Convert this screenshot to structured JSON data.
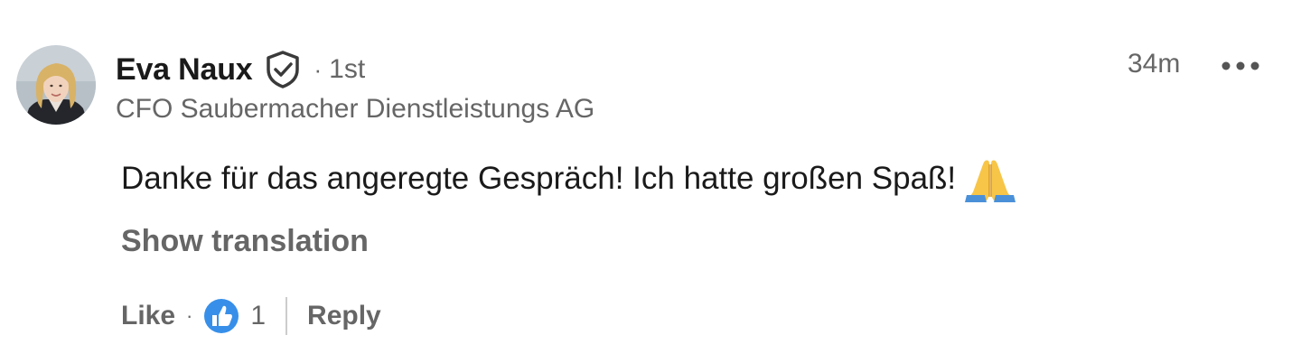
{
  "comment": {
    "author": {
      "name": "Eva Naux",
      "verified_icon": "verified-shield-icon",
      "separator": "·",
      "connection_degree": "1st",
      "headline": "CFO Saubermacher Dienstleistungs AG",
      "avatar": "avatar-photo"
    },
    "timestamp": "34m",
    "more_icon": "more-horizontal-icon",
    "text": "Danke für das angeregte Gespräch! Ich hatte großen Spaß!",
    "emoji_icon": "folded-hands-emoji",
    "show_translation_label": "Show translation",
    "actions": {
      "like_label": "Like",
      "separator": "·",
      "reaction_icon": "like-reaction-icon",
      "reaction_count": "1",
      "reply_label": "Reply"
    }
  },
  "colors": {
    "primary_text": "#1a1a1a",
    "secondary_text": "#666666",
    "like_blue": "#378fe9",
    "divider": "#cccccc",
    "background": "#ffffff"
  }
}
